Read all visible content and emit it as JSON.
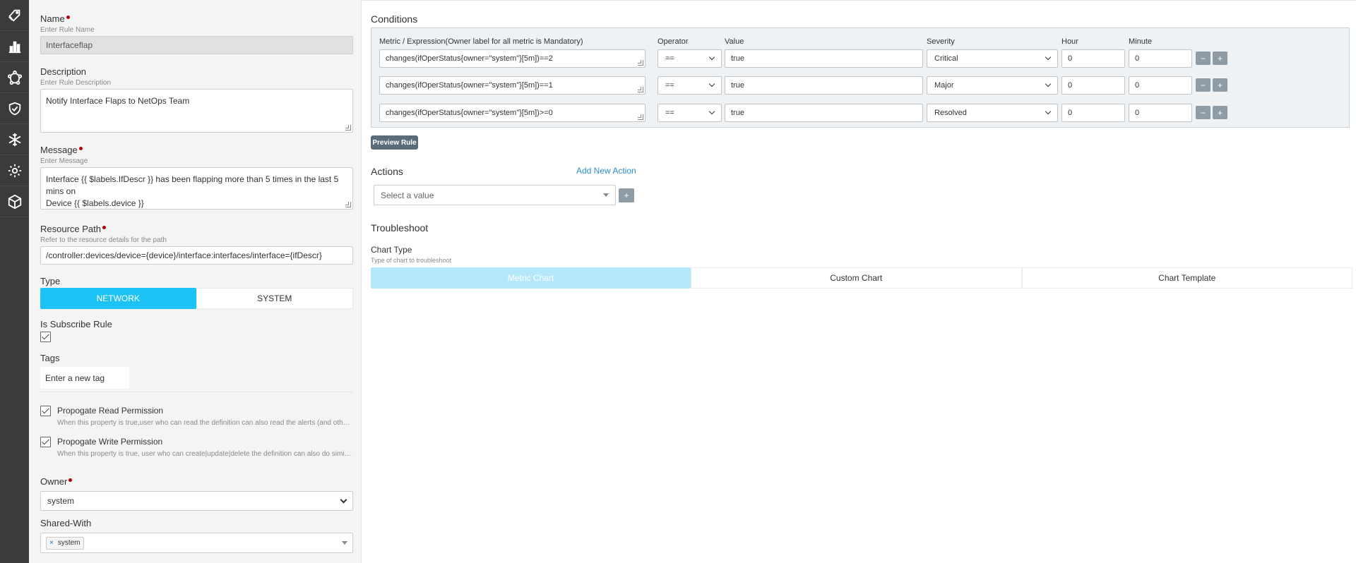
{
  "sidebar": {
    "items": [
      {
        "icon": "tags-icon"
      },
      {
        "icon": "bar-chart-icon"
      },
      {
        "icon": "network-nodes-icon"
      },
      {
        "icon": "shield-check-icon"
      },
      {
        "icon": "snowflake-icon"
      },
      {
        "icon": "gear-icon"
      },
      {
        "icon": "cube-icon"
      }
    ]
  },
  "form": {
    "name": {
      "label": "Name",
      "hint": "Enter Rule Name",
      "value": "Interfaceflap"
    },
    "description": {
      "label": "Description",
      "hint": "Enter Rule Description",
      "value": "Notify Interface Flaps to NetOps Team"
    },
    "message": {
      "label": "Message",
      "hint": "Enter Message",
      "line1": "Interface {{ $labels.IfDescr }} has been flapping more than 5 times in the last 5 mins on",
      "line2": "Device {{ $labels.device }}"
    },
    "resource_path": {
      "label": "Resource Path",
      "hint": "Refer to the resource details for the path",
      "value": "/controller:devices/device={device}/interface:interfaces/interface={ifDescr}"
    },
    "type": {
      "label": "Type",
      "options": [
        "NETWORK",
        "SYSTEM"
      ],
      "selected": "NETWORK"
    },
    "is_subscribe": {
      "label": "Is Subscribe Rule",
      "checked": true
    },
    "tags": {
      "label": "Tags",
      "placeholder": "Enter a new tag"
    },
    "read_perm": {
      "title": "Propogate Read Permission",
      "hint": "When this property is true,user who can read the definition can also read the alerts (and other downstream...",
      "checked": true
    },
    "write_perm": {
      "title": "Propogate Write Permission",
      "hint": "When this property is true, user who can create|update|delete the definition can also do similar actions to t...",
      "checked": true
    },
    "owner": {
      "label": "Owner",
      "value": "system"
    },
    "shared_with": {
      "label": "Shared-With",
      "tags": [
        "system"
      ],
      "remove": "×"
    }
  },
  "conditions": {
    "title": "Conditions",
    "headers": {
      "metric": "Metric / Expression(Owner label for all metric is Mandatory)",
      "operator": "Operator",
      "value": "Value",
      "severity": "Severity",
      "hour": "Hour",
      "minute": "Minute"
    },
    "rows": [
      {
        "metric": "changes(ifOperStatus{owner=\"system\"}[5m])==2",
        "operator": "==",
        "value": "true",
        "severity": "Critical",
        "hour": "0",
        "minute": "0"
      },
      {
        "metric": "changes(ifOperStatus{owner=\"system\"}[5m])==1",
        "operator": "==",
        "value": "true",
        "severity": "Major",
        "hour": "0",
        "minute": "0"
      },
      {
        "metric": "changes(ifOperStatus{owner=\"system\"}[5m])>=0",
        "operator": "==",
        "value": "true",
        "severity": "Resolved",
        "hour": "0",
        "minute": "0"
      }
    ],
    "minus": "−",
    "plus": "+",
    "preview_label": "Preview Rule"
  },
  "actions": {
    "title": "Actions",
    "add_label": "Add New Action",
    "select_placeholder": "Select a value",
    "plus": "+"
  },
  "troubleshoot": {
    "title": "Troubleshoot",
    "chart_type_label": "Chart Type",
    "chart_type_hint": "Type of chart to troubleshoot",
    "tabs": [
      "Metric Chart",
      "Custom Chart",
      "Chart Template"
    ],
    "active_tab": "Metric Chart"
  },
  "colors": {
    "sidebar_bg": "#3a3b3d",
    "accent": "#1ec3f5",
    "required": "#b0000b",
    "link": "#2e8ec9"
  }
}
